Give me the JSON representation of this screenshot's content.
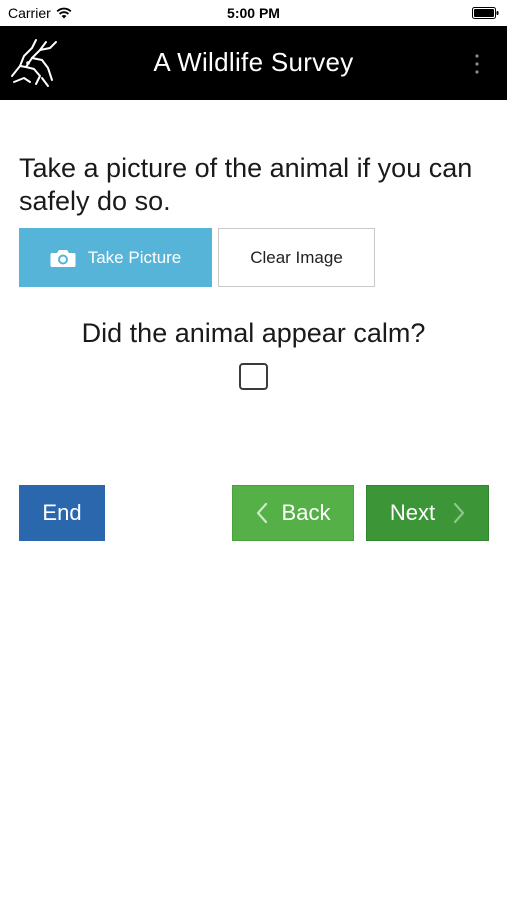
{
  "status_bar": {
    "carrier": "Carrier",
    "time": "5:00 PM",
    "wifi_icon": "wifi-icon",
    "battery_icon": "battery-icon"
  },
  "header": {
    "title": "A Wildlife Survey",
    "logo": "wildlife-logo",
    "menu_icon": "more-vertical-icon",
    "background_color": "#000000"
  },
  "form": {
    "picture_question": "Take a picture of the animal if you can safely do so.",
    "take_picture_label": "Take Picture",
    "take_picture_icon": "camera-icon",
    "clear_image_label": "Clear Image",
    "calm_question": "Did the animal appear calm?",
    "calm_checked": false
  },
  "navigation": {
    "end_label": "End",
    "back_label": "Back",
    "next_label": "Next"
  },
  "colors": {
    "take_picture": "#55b4d8",
    "end": "#2a67ad",
    "back": "#54b047",
    "next": "#3c9638"
  }
}
